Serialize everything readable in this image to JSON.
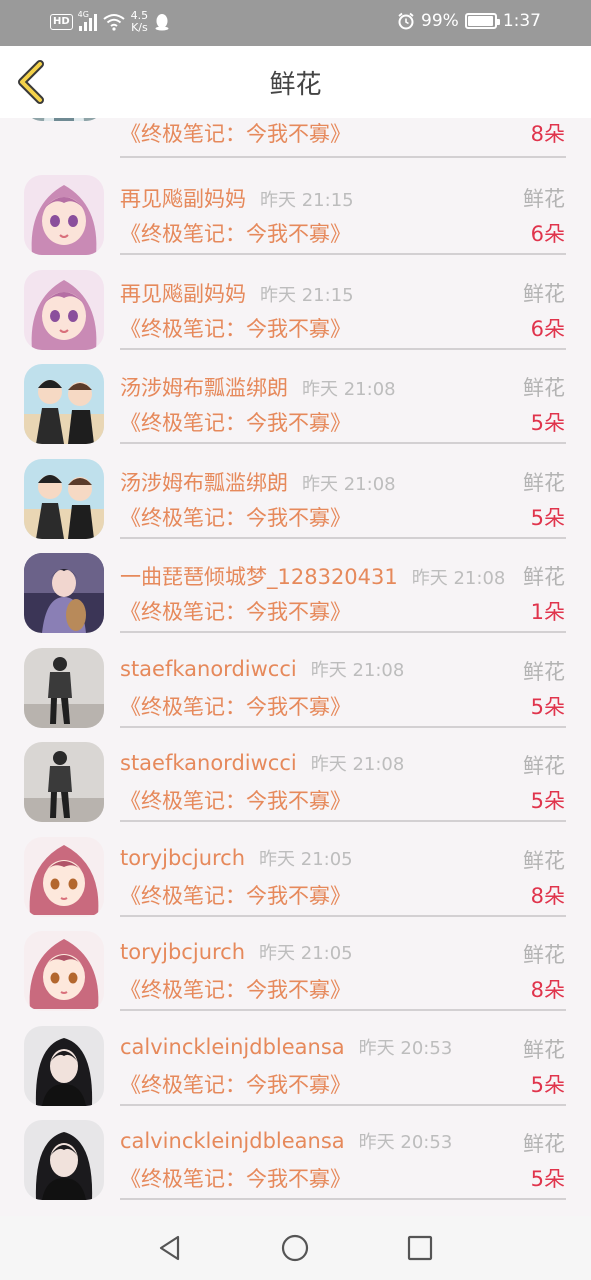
{
  "status_bar": {
    "hd": "HD",
    "network": "4G",
    "speed_value": "4.5",
    "speed_unit": "K/s",
    "battery": "99%",
    "time": "1:37"
  },
  "header": {
    "title": "鲜花"
  },
  "rows": [
    {
      "name": "",
      "time": "",
      "gift": "",
      "book": "《终极笔记：今我不寡》",
      "count": "8朵",
      "avatar": "man-photo"
    },
    {
      "name": "再见飚副妈妈",
      "time": "昨天 21:15",
      "gift": "鲜花",
      "book": "《终极笔记：今我不寡》",
      "count": "6朵",
      "avatar": "anime-girl-pink"
    },
    {
      "name": "再见飚副妈妈",
      "time": "昨天 21:15",
      "gift": "鲜花",
      "book": "《终极笔记：今我不寡》",
      "count": "6朵",
      "avatar": "anime-girl-pink"
    },
    {
      "name": "汤涉姆布瓢滥绑朗",
      "time": "昨天 21:08",
      "gift": "鲜花",
      "book": "《终极笔记：今我不寡》",
      "count": "5朵",
      "avatar": "cartoon-boys"
    },
    {
      "name": "汤涉姆布瓢滥绑朗",
      "time": "昨天 21:08",
      "gift": "鲜花",
      "book": "《终极笔记：今我不寡》",
      "count": "5朵",
      "avatar": "cartoon-boys"
    },
    {
      "name": "一曲琵琶倾城梦_128320431",
      "time": "昨天 21:08",
      "gift": "鲜花",
      "book": "《终极笔记：今我不寡》",
      "count": "1朵",
      "avatar": "pipa-girl"
    },
    {
      "name": "staefkanordiwcci",
      "time": "昨天 21:08",
      "gift": "鲜花",
      "book": "《终极笔记：今我不寡》",
      "count": "5朵",
      "avatar": "dark-man"
    },
    {
      "name": "staefkanordiwcci",
      "time": "昨天 21:08",
      "gift": "鲜花",
      "book": "《终极笔记：今我不寡》",
      "count": "5朵",
      "avatar": "dark-man"
    },
    {
      "name": "toryjbcjurch",
      "time": "昨天 21:05",
      "gift": "鲜花",
      "book": "《终极笔记：今我不寡》",
      "count": "8朵",
      "avatar": "anime-girl-red"
    },
    {
      "name": "toryjbcjurch",
      "time": "昨天 21:05",
      "gift": "鲜花",
      "book": "《终极笔记：今我不寡》",
      "count": "8朵",
      "avatar": "anime-girl-red"
    },
    {
      "name": "calvinckleinjdbleansa",
      "time": "昨天 20:53",
      "gift": "鲜花",
      "book": "《终极笔记：今我不寡》",
      "count": "5朵",
      "avatar": "black-hair-girl"
    },
    {
      "name": "calvinckleinjdbleansa",
      "time": "昨天 20:53",
      "gift": "鲜花",
      "book": "《终极笔记：今我不寡》",
      "count": "5朵",
      "avatar": "black-hair-girl"
    }
  ],
  "nav": {
    "back": "back-triangle-icon",
    "home": "home-circle-icon",
    "recent": "recent-square-icon"
  },
  "colors": {
    "name": "#e6895b",
    "count": "#e0344c",
    "gift": "#b3b3b3",
    "time": "#bdbdbd",
    "back_arrow": "#f4d24a"
  }
}
